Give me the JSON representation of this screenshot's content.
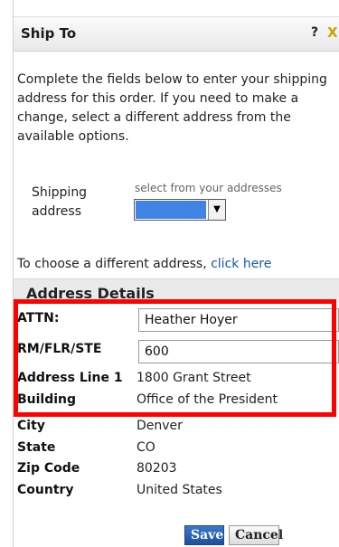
{
  "dialog": {
    "title": "Ship To",
    "help_label": "?",
    "close_label": "X"
  },
  "intro_text": "Complete the fields below to enter your shipping address for this order. If you need to make a change, select a different address from the available options.",
  "shipping": {
    "label": "Shipping address",
    "hint": "select from your addresses",
    "selected_value": ""
  },
  "choose": {
    "text": "To choose a different address, ",
    "link": "click here"
  },
  "address_details": {
    "title": "Address Details",
    "fields": {
      "attn_label": "ATTN:",
      "attn_value": "Heather Hoyer",
      "rm_label": "RM/FLR/STE",
      "rm_value": "600",
      "line1_label": "Address Line 1",
      "line1_value": "1800 Grant Street",
      "building_label": "Building",
      "building_value": "Office of the President",
      "city_label": "City",
      "city_value": "Denver",
      "state_label": "State",
      "state_value": "CO",
      "zip_label": "Zip Code",
      "zip_value": "80203",
      "country_label": "Country",
      "country_value": "United States"
    }
  },
  "buttons": {
    "save": "Save",
    "cancel": "Cancel"
  },
  "colors": {
    "highlight": "#ff0000",
    "select_fill": "#3f84e5",
    "save_button": "#1d4f9c",
    "link": "#1a56a8"
  }
}
